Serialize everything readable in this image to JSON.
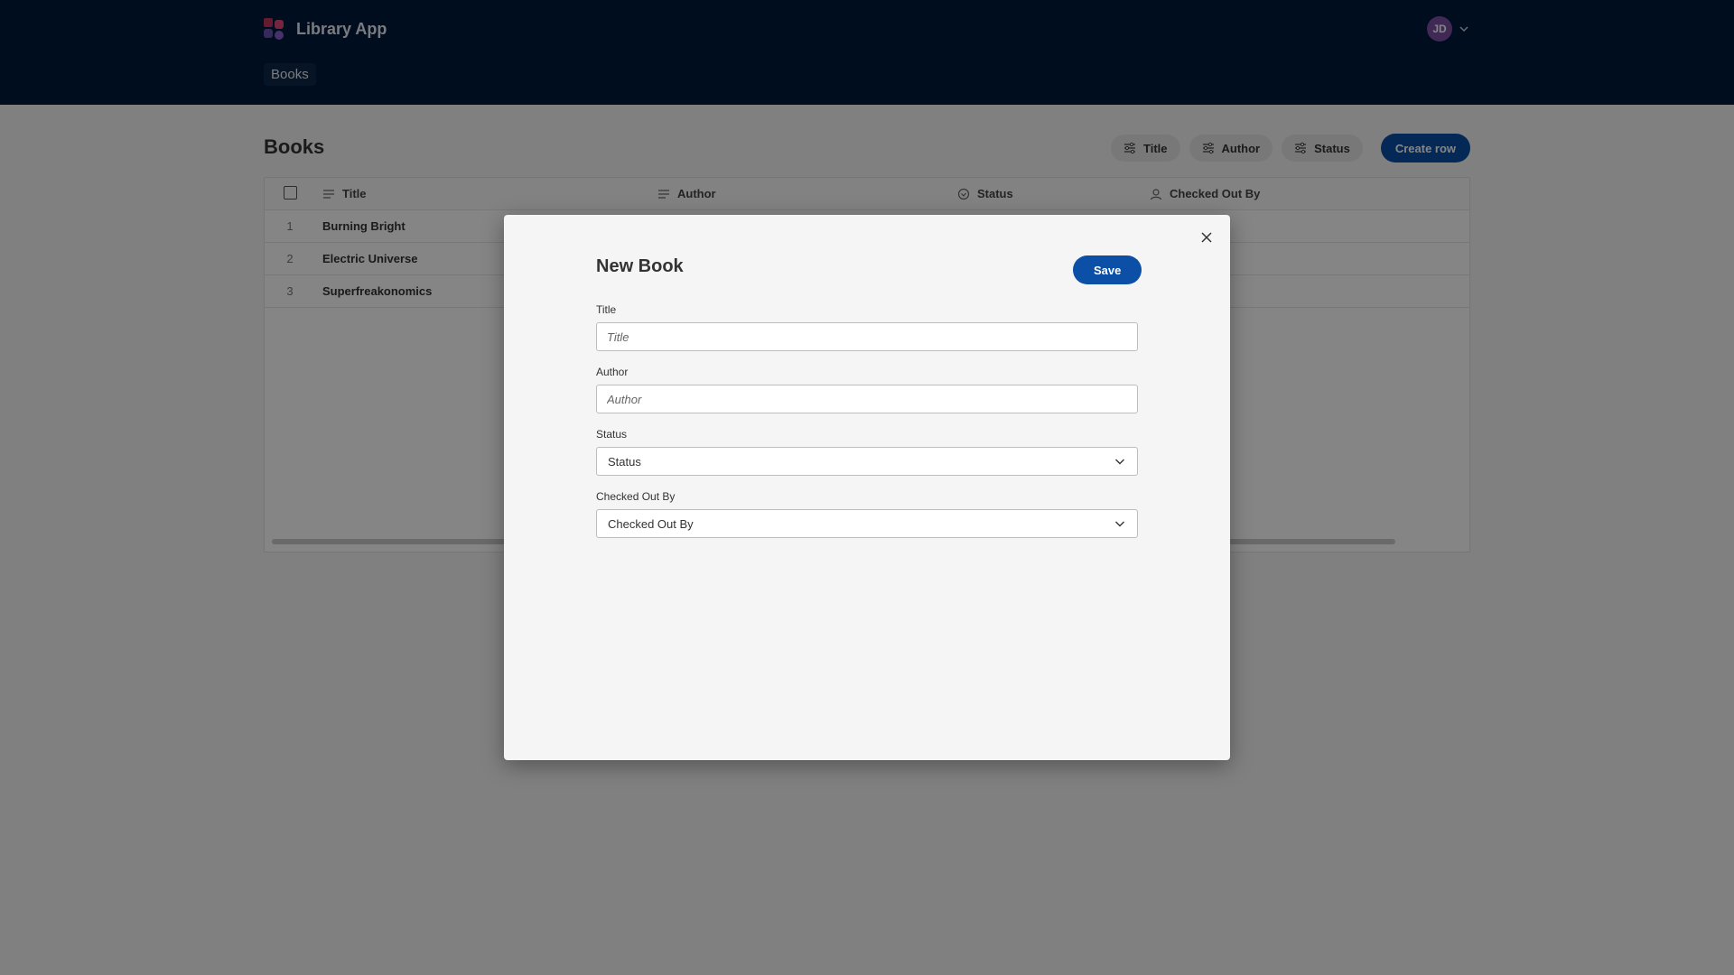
{
  "app": {
    "name": "Library App",
    "nav": [
      "Books"
    ]
  },
  "user": {
    "initials": "JD"
  },
  "page": {
    "title": "Books",
    "filters": [
      "Title",
      "Author",
      "Status"
    ],
    "create_label": "Create row"
  },
  "table": {
    "columns": [
      "Title",
      "Author",
      "Status",
      "Checked Out By"
    ],
    "rows": [
      {
        "num": "1",
        "title": "Burning Bright"
      },
      {
        "num": "2",
        "title": "Electric Universe"
      },
      {
        "num": "3",
        "title": "Superfreakonomics"
      }
    ]
  },
  "modal": {
    "title": "New Book",
    "save_label": "Save",
    "fields": {
      "title": {
        "label": "Title",
        "placeholder": "Title"
      },
      "author": {
        "label": "Author",
        "placeholder": "Author"
      },
      "status": {
        "label": "Status",
        "value": "Status"
      },
      "checked_out_by": {
        "label": "Checked Out By",
        "value": "Checked Out By"
      }
    }
  },
  "colors": {
    "header": "#001a3d",
    "accent": "#0b4fa6",
    "avatar": "#7b4fa3"
  },
  "icons": [
    "app-logo-icon",
    "chevron-down-icon",
    "filter-icon",
    "text-lines-icon",
    "status-circle-icon",
    "user-icon",
    "close-icon"
  ]
}
